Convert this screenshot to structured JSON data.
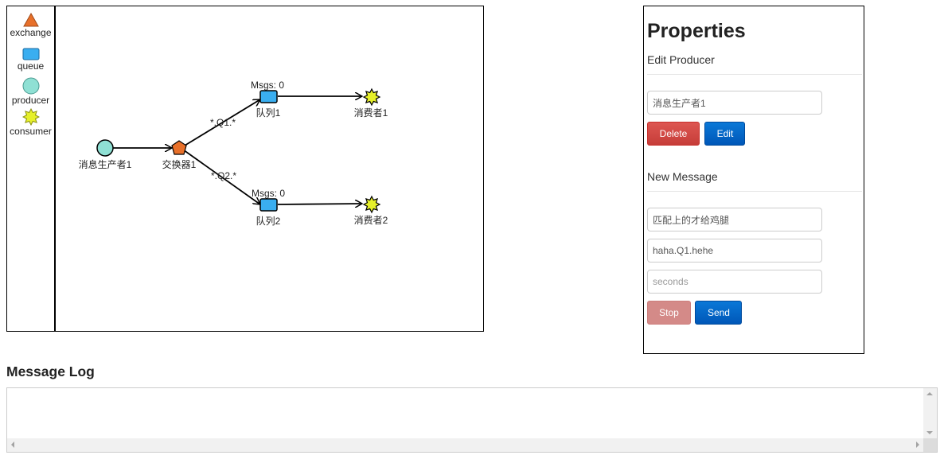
{
  "palette": {
    "items": [
      {
        "label": "exchange",
        "icon": "triangle-icon",
        "color": "#e8702a"
      },
      {
        "label": "queue",
        "icon": "rectangle-icon",
        "color": "#3aaef0"
      },
      {
        "label": "producer",
        "icon": "circle-icon",
        "color": "#8fe0d4"
      },
      {
        "label": "consumer",
        "icon": "star-icon",
        "color": "#e6f02a"
      }
    ]
  },
  "diagram": {
    "producer": {
      "label": "消息生产者1"
    },
    "exchange": {
      "label": "交换器1"
    },
    "queues": [
      {
        "label": "队列1",
        "msgs": "Msgs: 0",
        "binding": "*.Q1.*"
      },
      {
        "label": "队列2",
        "msgs": "Msgs: 0",
        "binding": "*.Q2.*"
      }
    ],
    "consumers": [
      {
        "label": "消费者1"
      },
      {
        "label": "消费者2"
      }
    ]
  },
  "properties": {
    "title": "Properties",
    "edit_section": "Edit Producer",
    "producer_name": "消息生产者1",
    "delete_label": "Delete",
    "edit_label": "Edit",
    "message_section": "New Message",
    "message_text": "匹配上的才给鸡腿",
    "routing_key": "haha.Q1.hehe",
    "seconds_placeholder": "seconds",
    "stop_label": "Stop",
    "send_label": "Send"
  },
  "log": {
    "title": "Message Log",
    "content": ""
  },
  "colors": {
    "exchange": "#e8702a",
    "queue": "#3aaef0",
    "producer": "#8fe0d4",
    "consumer": "#e6f02a",
    "delete": "#d9534f",
    "primary": "#0066cc"
  }
}
